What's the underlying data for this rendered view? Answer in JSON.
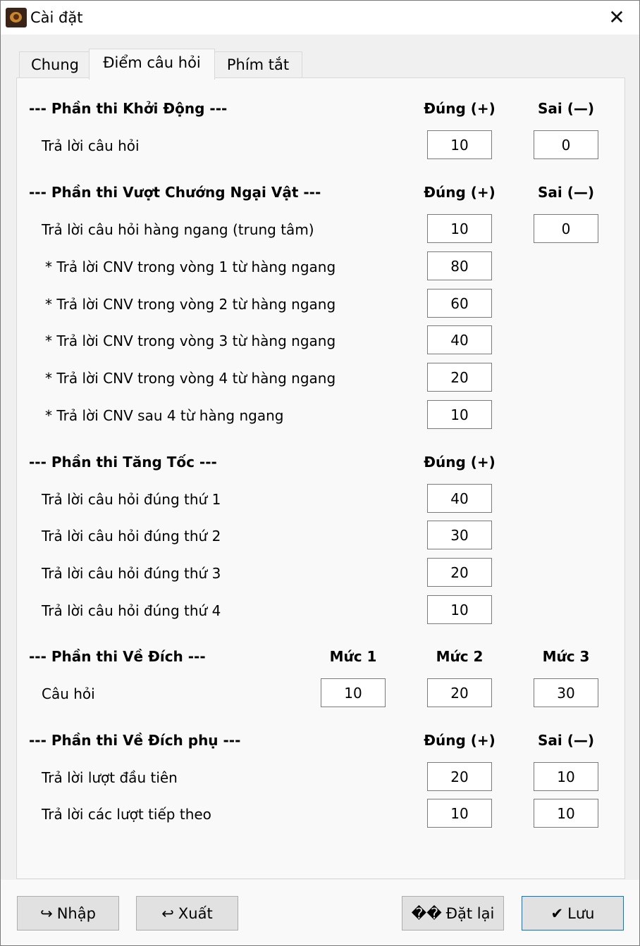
{
  "window": {
    "title": "Cài đặt",
    "close_symbol": "✕"
  },
  "tabs": [
    {
      "label": "Chung"
    },
    {
      "label": "Điểm câu hỏi"
    },
    {
      "label": "Phím tắt"
    }
  ],
  "sections": {
    "khoi_dong": {
      "title": "--- Phần thi Khởi Động ---",
      "col_correct": "Đúng (+)",
      "col_wrong": "Sai (—)",
      "rows": [
        {
          "label": "Trả lời câu hỏi",
          "correct": "10",
          "wrong": "0"
        }
      ]
    },
    "vuot_chuong_ngai_vat": {
      "title": "--- Phần thi Vượt Chướng Ngại Vật ---",
      "col_correct": "Đúng (+)",
      "col_wrong": "Sai (—)",
      "rows": [
        {
          "label": "Trả lời câu hỏi hàng ngang (trung tâm)",
          "correct": "10",
          "wrong": "0"
        },
        {
          "label": "* Trả lời CNV trong vòng 1 từ hàng ngang",
          "correct": "80"
        },
        {
          "label": "* Trả lời CNV trong vòng 2 từ hàng ngang",
          "correct": "60"
        },
        {
          "label": "* Trả lời CNV trong vòng 3 từ hàng ngang",
          "correct": "40"
        },
        {
          "label": "* Trả lời CNV trong vòng 4 từ hàng ngang",
          "correct": "20"
        },
        {
          "label": "* Trả lời CNV sau 4 từ hàng ngang",
          "correct": "10"
        }
      ]
    },
    "tang_toc": {
      "title": "--- Phần thi Tăng Tốc ---",
      "col_correct": "Đúng (+)",
      "rows": [
        {
          "label": "Trả lời câu hỏi đúng thứ 1",
          "correct": "40"
        },
        {
          "label": "Trả lời câu hỏi đúng thứ 2",
          "correct": "30"
        },
        {
          "label": "Trả lời câu hỏi đúng thứ 3",
          "correct": "20"
        },
        {
          "label": "Trả lời câu hỏi đúng thứ 4",
          "correct": "10"
        }
      ]
    },
    "ve_dich": {
      "title": "--- Phần thi Về Đích ---",
      "col_1": "Mức 1",
      "col_2": "Mức 2",
      "col_3": "Mức 3",
      "rows": [
        {
          "label": "Câu hỏi",
          "level1": "10",
          "level2": "20",
          "level3": "30"
        }
      ]
    },
    "ve_dich_phu": {
      "title": "--- Phần thi Về Đích phụ ---",
      "col_correct": "Đúng (+)",
      "col_wrong": "Sai (—)",
      "rows": [
        {
          "label": "Trả lời lượt đầu tiên",
          "correct": "20",
          "wrong": "10"
        },
        {
          "label": "Trả lời các lượt tiếp theo",
          "correct": "10",
          "wrong": "10"
        }
      ]
    }
  },
  "buttons": {
    "import": {
      "icon": "↪",
      "label": "Nhập"
    },
    "export": {
      "icon": "↩",
      "label": "Xuất"
    },
    "reset": {
      "icon": "��",
      "label": "Đặt lại"
    },
    "save": {
      "icon": "✔",
      "label": "Lưu"
    }
  }
}
